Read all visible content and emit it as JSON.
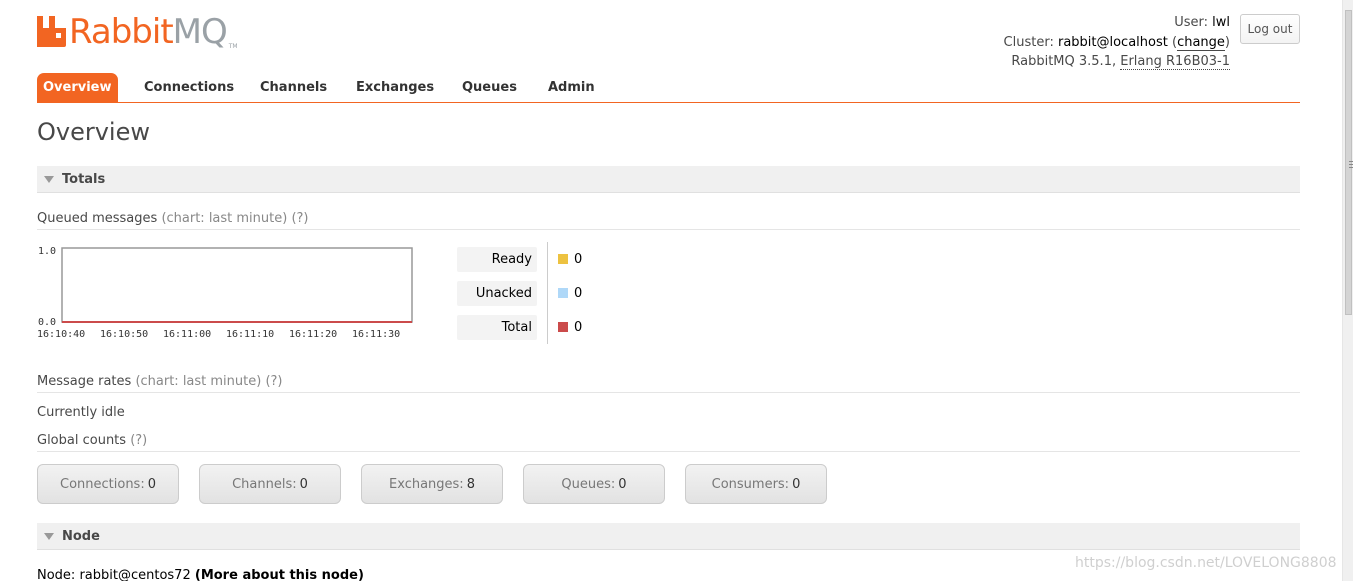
{
  "header": {
    "logo_rabbit": "Rabbit",
    "logo_mq": "MQ",
    "logo_tm": "TM",
    "user_label": "User:",
    "user_value": "lwl",
    "cluster_label": "Cluster:",
    "cluster_value": "rabbit@localhost",
    "change_label": "change",
    "version_text": "RabbitMQ 3.5.1,",
    "erlang_text": "Erlang R16B03-1",
    "logout_label": "Log out"
  },
  "tabs": [
    {
      "label": "Overview",
      "active": true
    },
    {
      "label": "Connections",
      "active": false
    },
    {
      "label": "Channels",
      "active": false
    },
    {
      "label": "Exchanges",
      "active": false
    },
    {
      "label": "Queues",
      "active": false
    },
    {
      "label": "Admin",
      "active": false
    }
  ],
  "page_title": "Overview",
  "totals": {
    "title": "Totals",
    "queued_label": "Queued messages",
    "queued_help": "(chart: last minute) (?)",
    "legend": [
      {
        "label": "Ready",
        "value": "0",
        "color": "#edc240"
      },
      {
        "label": "Unacked",
        "value": "0",
        "color": "#afd8f8"
      },
      {
        "label": "Total",
        "value": "0",
        "color": "#cb4b4b"
      }
    ],
    "rates_label": "Message rates",
    "rates_help": "(chart: last minute) (?)",
    "idle_text": "Currently idle",
    "global_label": "Global counts",
    "global_help": "(?)",
    "counts": [
      {
        "label": "Connections:",
        "value": "0"
      },
      {
        "label": "Channels:",
        "value": "0"
      },
      {
        "label": "Exchanges:",
        "value": "8"
      },
      {
        "label": "Queues:",
        "value": "0"
      },
      {
        "label": "Consumers:",
        "value": "0"
      }
    ]
  },
  "chart_data": {
    "type": "line",
    "x": [
      "16:10:40",
      "16:10:50",
      "16:11:00",
      "16:11:10",
      "16:11:20",
      "16:11:30"
    ],
    "y_ticks": [
      "1.0",
      "0.0"
    ],
    "ylim": [
      0,
      1
    ],
    "series": [
      {
        "name": "Ready",
        "values": [
          0,
          0,
          0,
          0,
          0,
          0
        ]
      },
      {
        "name": "Unacked",
        "values": [
          0,
          0,
          0,
          0,
          0,
          0
        ]
      },
      {
        "name": "Total",
        "values": [
          0,
          0,
          0,
          0,
          0,
          0
        ]
      }
    ]
  },
  "node": {
    "title": "Node",
    "label": "Node:",
    "value": "rabbit@centos72",
    "more_link": "(More about this node)"
  },
  "watermark": "https://blog.csdn.net/LOVELONG8808"
}
